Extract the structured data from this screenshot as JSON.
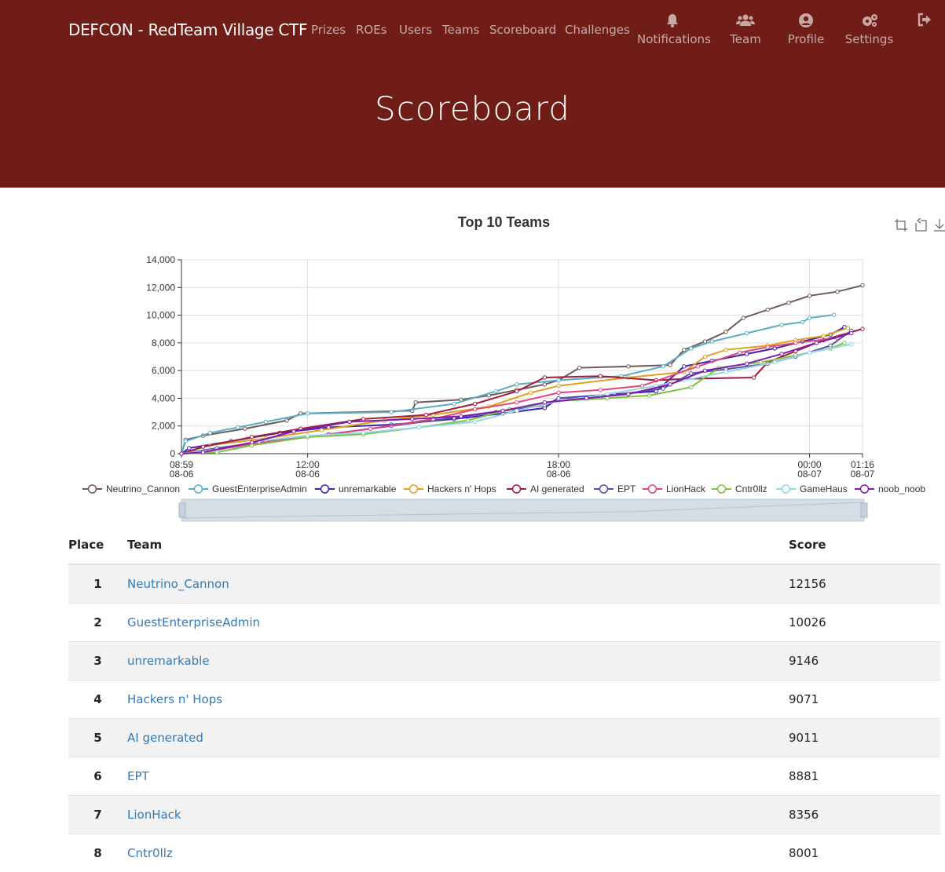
{
  "nav": {
    "brand": "DEFCON - RedTeam Village CTF",
    "links": [
      "Prizes",
      "ROEs",
      "Users",
      "Teams",
      "Scoreboard",
      "Challenges"
    ],
    "icons": [
      {
        "label": "Notifications",
        "icon": "bell-icon"
      },
      {
        "label": "Team",
        "icon": "users-icon"
      },
      {
        "label": "Profile",
        "icon": "user-circle-icon"
      },
      {
        "label": "Settings",
        "icon": "gears-icon"
      },
      {
        "label": "",
        "icon": "sign-out-icon"
      }
    ]
  },
  "page": {
    "title": "Scoreboard"
  },
  "chart_data": {
    "type": "line",
    "title": "Top 10 Teams",
    "xlabel": "",
    "ylabel": "",
    "ylim": [
      0,
      14000
    ],
    "xlim": [
      "08-06 08:59",
      "08-07 01:16"
    ],
    "y_ticks": [
      "0",
      "2,000",
      "4,000",
      "6,000",
      "8,000",
      "10,000",
      "12,000",
      "14,000"
    ],
    "x_ticks": [
      {
        "time": "08:59",
        "date": "08-06",
        "at": "08-06 08:59"
      },
      {
        "time": "12:00",
        "date": "08-06",
        "at": "08-06 12:00"
      },
      {
        "time": "18:00",
        "date": "08-06",
        "at": "08-06 18:00"
      },
      {
        "time": "00:00",
        "date": "08-07",
        "at": "08-07 00:00"
      },
      {
        "time": "01:16",
        "date": "08-07",
        "at": "08-07 01:16"
      }
    ],
    "grid": true,
    "legend_position": "bottom",
    "series": [
      {
        "name": "Neutrino_Cannon",
        "color": "#6e5b59",
        "points": [
          [
            "08-06 08:59",
            0
          ],
          [
            "08-06 09:05",
            1000
          ],
          [
            "08-06 09:30",
            1300
          ],
          [
            "08-06 10:30",
            1800
          ],
          [
            "08-06 11:30",
            2400
          ],
          [
            "08-06 11:50",
            2900
          ],
          [
            "08-06 14:30",
            3100
          ],
          [
            "08-06 14:35",
            3700
          ],
          [
            "08-06 15:40",
            3900
          ],
          [
            "08-06 16:20",
            4200
          ],
          [
            "08-06 17:00",
            4600
          ],
          [
            "08-06 17:40",
            5000
          ],
          [
            "08-06 18:00",
            5300
          ],
          [
            "08-06 18:30",
            6200
          ],
          [
            "08-06 19:40",
            6300
          ],
          [
            "08-06 20:40",
            6400
          ],
          [
            "08-06 21:00",
            7500
          ],
          [
            "08-06 21:30",
            8100
          ],
          [
            "08-06 22:00",
            8800
          ],
          [
            "08-06 22:25",
            9800
          ],
          [
            "08-06 23:00",
            10400
          ],
          [
            "08-06 23:30",
            10900
          ],
          [
            "08-07 00:00",
            11400
          ],
          [
            "08-07 00:40",
            11700
          ],
          [
            "08-07 01:16",
            12156
          ]
        ]
      },
      {
        "name": "GuestEnterpriseAdmin",
        "color": "#5aaec4",
        "points": [
          [
            "08-06 08:59",
            0
          ],
          [
            "08-06 09:05",
            900
          ],
          [
            "08-06 09:40",
            1500
          ],
          [
            "08-06 10:20",
            1900
          ],
          [
            "08-06 11:00",
            2300
          ],
          [
            "08-06 12:00",
            2900
          ],
          [
            "08-06 14:00",
            3000
          ],
          [
            "08-06 15:30",
            3600
          ],
          [
            "08-06 16:30",
            4500
          ],
          [
            "08-06 17:00",
            5000
          ],
          [
            "08-06 18:00",
            5300
          ],
          [
            "08-06 19:30",
            5600
          ],
          [
            "08-06 20:30",
            6300
          ],
          [
            "08-06 21:10",
            7600
          ],
          [
            "08-06 21:40",
            8100
          ],
          [
            "08-06 22:30",
            8700
          ],
          [
            "08-06 23:20",
            9300
          ],
          [
            "08-06 23:50",
            9500
          ],
          [
            "08-07 00:00",
            9800
          ],
          [
            "08-07 00:35",
            10026
          ]
        ]
      },
      {
        "name": "unremarkable",
        "color": "#3c25b0",
        "points": [
          [
            "08-06 08:59",
            0
          ],
          [
            "08-06 09:10",
            400
          ],
          [
            "08-06 10:10",
            900
          ],
          [
            "08-06 11:20",
            1500
          ],
          [
            "08-06 12:30",
            1900
          ],
          [
            "08-06 14:00",
            2100
          ],
          [
            "08-06 15:30",
            2500
          ],
          [
            "08-06 16:40",
            2900
          ],
          [
            "08-06 17:40",
            3300
          ],
          [
            "08-06 18:00",
            4000
          ],
          [
            "08-06 19:20",
            4300
          ],
          [
            "08-06 20:20",
            4500
          ],
          [
            "08-06 21:00",
            6300
          ],
          [
            "08-06 21:40",
            6700
          ],
          [
            "08-06 22:30",
            7200
          ],
          [
            "08-06 23:10",
            7600
          ],
          [
            "08-06 23:50",
            8100
          ],
          [
            "08-07 00:30",
            8600
          ],
          [
            "08-07 00:50",
            9146
          ]
        ]
      },
      {
        "name": "Hackers n' Hops",
        "color": "#dca121",
        "points": [
          [
            "08-06 08:59",
            0
          ],
          [
            "08-06 09:40",
            600
          ],
          [
            "08-06 11:00",
            1100
          ],
          [
            "08-06 12:20",
            1700
          ],
          [
            "08-06 13:50",
            2400
          ],
          [
            "08-06 15:00",
            2800
          ],
          [
            "08-06 16:20",
            3400
          ],
          [
            "08-06 17:20",
            4400
          ],
          [
            "08-06 18:00",
            4900
          ],
          [
            "08-06 19:40",
            5500
          ],
          [
            "08-06 21:00",
            5900
          ],
          [
            "08-06 21:30",
            7000
          ],
          [
            "08-06 22:00",
            7500
          ],
          [
            "08-06 23:00",
            7800
          ],
          [
            "08-06 23:40",
            8200
          ],
          [
            "08-07 00:20",
            8500
          ],
          [
            "08-07 00:55",
            9071
          ]
        ]
      },
      {
        "name": "AI generated",
        "color": "#a01c3c",
        "points": [
          [
            "08-06 08:59",
            0
          ],
          [
            "08-06 09:30",
            500
          ],
          [
            "08-06 10:40",
            1200
          ],
          [
            "08-06 11:50",
            1800
          ],
          [
            "08-06 13:20",
            2500
          ],
          [
            "08-06 14:50",
            2800
          ],
          [
            "08-06 16:00",
            3600
          ],
          [
            "08-06 17:00",
            4500
          ],
          [
            "08-06 17:40",
            5500
          ],
          [
            "08-06 19:00",
            5600
          ],
          [
            "08-06 20:20",
            5300
          ],
          [
            "08-06 21:00",
            5400
          ],
          [
            "08-06 22:40",
            5500
          ],
          [
            "08-06 23:00",
            6600
          ],
          [
            "08-06 23:40",
            7400
          ],
          [
            "08-07 00:20",
            8200
          ],
          [
            "08-07 01:16",
            9011
          ]
        ]
      },
      {
        "name": "EPT",
        "color": "#5a4fa8",
        "points": [
          [
            "08-06 08:59",
            0
          ],
          [
            "08-06 09:50",
            400
          ],
          [
            "08-06 11:00",
            900
          ],
          [
            "08-06 12:30",
            1400
          ],
          [
            "08-06 14:00",
            2000
          ],
          [
            "08-06 15:30",
            2600
          ],
          [
            "08-06 16:30",
            3000
          ],
          [
            "08-06 17:40",
            3500
          ],
          [
            "08-06 18:00",
            4000
          ],
          [
            "08-06 19:00",
            4100
          ],
          [
            "08-06 20:30",
            4700
          ],
          [
            "08-06 21:10",
            5800
          ],
          [
            "08-06 22:00",
            6100
          ],
          [
            "08-06 23:00",
            6500
          ],
          [
            "08-06 23:40",
            7000
          ],
          [
            "08-07 00:30",
            7800
          ],
          [
            "08-07 01:00",
            8881
          ]
        ]
      },
      {
        "name": "LionHack",
        "color": "#e0457b",
        "points": [
          [
            "08-06 08:59",
            0
          ],
          [
            "08-06 09:40",
            200
          ],
          [
            "08-06 10:40",
            700
          ],
          [
            "08-06 12:00",
            1200
          ],
          [
            "08-06 13:30",
            1800
          ],
          [
            "08-06 15:00",
            2500
          ],
          [
            "08-06 16:00",
            3200
          ],
          [
            "08-06 17:00",
            3700
          ],
          [
            "08-06 18:00",
            4400
          ],
          [
            "08-06 19:00",
            4600
          ],
          [
            "08-06 20:00",
            4900
          ],
          [
            "08-06 21:20",
            6300
          ],
          [
            "08-06 22:20",
            7300
          ],
          [
            "08-06 23:00",
            7700
          ],
          [
            "08-06 23:40",
            8000
          ],
          [
            "08-07 00:40",
            8356
          ]
        ]
      },
      {
        "name": "Cntr0llz",
        "color": "#7cc242",
        "points": [
          [
            "08-06 08:59",
            0
          ],
          [
            "08-06 09:50",
            100
          ],
          [
            "08-06 10:40",
            600
          ],
          [
            "08-06 12:00",
            1200
          ],
          [
            "08-06 13:20",
            1400
          ],
          [
            "08-06 14:40",
            1900
          ],
          [
            "08-06 15:50",
            2400
          ],
          [
            "08-06 16:50",
            3200
          ],
          [
            "08-06 18:00",
            3800
          ],
          [
            "08-06 19:10",
            4000
          ],
          [
            "08-06 20:10",
            4200
          ],
          [
            "08-06 21:10",
            4800
          ],
          [
            "08-06 21:50",
            6200
          ],
          [
            "08-06 22:50",
            6600
          ],
          [
            "08-06 23:40",
            7100
          ],
          [
            "08-07 00:30",
            7600
          ],
          [
            "08-07 00:50",
            8001
          ]
        ]
      },
      {
        "name": "GameHaus",
        "color": "#96d4e4",
        "points": [
          [
            "08-06 08:59",
            0
          ],
          [
            "08-06 09:50",
            300
          ],
          [
            "08-06 10:50",
            900
          ],
          [
            "08-06 12:00",
            1300
          ],
          [
            "08-06 13:20",
            1500
          ],
          [
            "08-06 14:40",
            1900
          ],
          [
            "08-06 16:00",
            2300
          ],
          [
            "08-06 17:00",
            3100
          ],
          [
            "08-06 18:00",
            3800
          ],
          [
            "08-06 19:10",
            4300
          ],
          [
            "08-06 20:20",
            4900
          ],
          [
            "08-06 21:00",
            5300
          ],
          [
            "08-06 22:00",
            5900
          ],
          [
            "08-06 23:10",
            6600
          ],
          [
            "08-07 00:00",
            7300
          ],
          [
            "08-07 01:00",
            7900
          ]
        ]
      },
      {
        "name": "noob_noob",
        "color": "#7f1dab",
        "points": [
          [
            "08-06 08:59",
            0
          ],
          [
            "08-06 09:30",
            100
          ],
          [
            "08-06 10:40",
            800
          ],
          [
            "08-06 11:40",
            1600
          ],
          [
            "08-06 13:00",
            2300
          ],
          [
            "08-06 14:30",
            2500
          ],
          [
            "08-06 15:40",
            2700
          ],
          [
            "08-06 16:40",
            3100
          ],
          [
            "08-06 17:40",
            3700
          ],
          [
            "08-06 18:40",
            4000
          ],
          [
            "08-06 19:40",
            4300
          ],
          [
            "08-06 20:40",
            5000
          ],
          [
            "08-06 21:30",
            6000
          ],
          [
            "08-06 22:30",
            6500
          ],
          [
            "08-06 23:20",
            7200
          ],
          [
            "08-07 00:10",
            8000
          ],
          [
            "08-07 01:00",
            8700
          ]
        ]
      }
    ]
  },
  "table": {
    "headers": {
      "place": "Place",
      "team": "Team",
      "score": "Score"
    },
    "rows": [
      {
        "place": "1",
        "team": "Neutrino_Cannon",
        "score": "12156"
      },
      {
        "place": "2",
        "team": "GuestEnterpriseAdmin",
        "score": "10026"
      },
      {
        "place": "3",
        "team": "unremarkable",
        "score": "9146"
      },
      {
        "place": "4",
        "team": "Hackers n' Hops",
        "score": "9071"
      },
      {
        "place": "5",
        "team": "AI generated",
        "score": "9011"
      },
      {
        "place": "6",
        "team": "EPT",
        "score": "8881"
      },
      {
        "place": "7",
        "team": "LionHack",
        "score": "8356"
      },
      {
        "place": "8",
        "team": "Cntr0llz",
        "score": "8001"
      }
    ]
  }
}
